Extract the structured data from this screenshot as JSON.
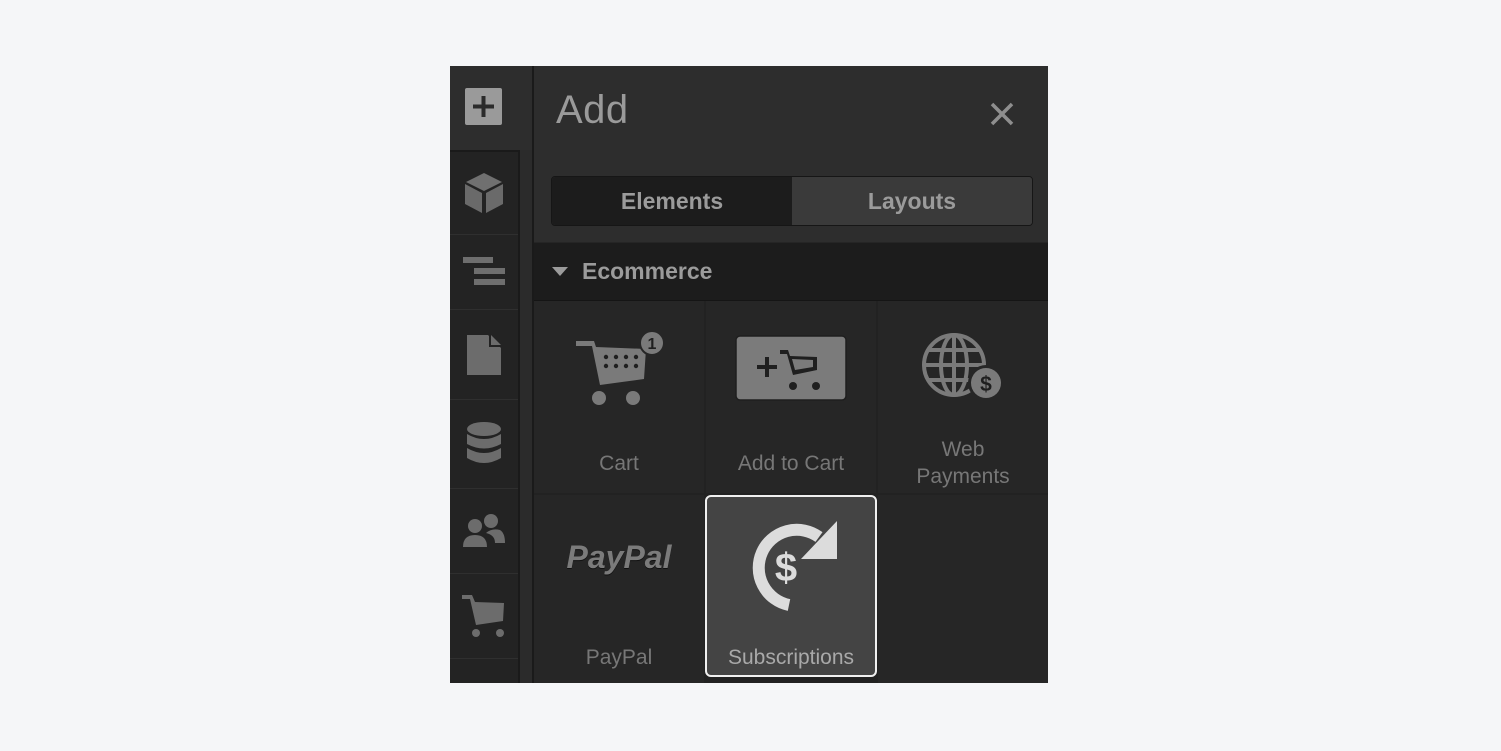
{
  "rail": {
    "items": [
      {
        "name": "add",
        "icon": "plus-box-icon"
      },
      {
        "name": "components",
        "icon": "cube-icon"
      },
      {
        "name": "navigator",
        "icon": "navigator-lines-icon"
      },
      {
        "name": "pages",
        "icon": "page-icon"
      },
      {
        "name": "cms",
        "icon": "database-icon"
      },
      {
        "name": "users",
        "icon": "users-icon"
      },
      {
        "name": "ecommerce",
        "icon": "cart-icon"
      }
    ]
  },
  "panel": {
    "title": "Add",
    "close_icon": "close-icon",
    "tabs": [
      {
        "label": "Elements",
        "active": true
      },
      {
        "label": "Layouts",
        "active": false
      }
    ],
    "section": {
      "label": "Ecommerce",
      "expanded": true,
      "items": [
        {
          "label": "Cart",
          "icon": "cart-with-badge-icon",
          "badge": "1",
          "selected": false
        },
        {
          "label": "Add to Cart",
          "icon": "add-to-cart-icon",
          "selected": false
        },
        {
          "label_line1": "Web",
          "label_line2": "Payments",
          "icon": "globe-dollar-icon",
          "selected": false
        },
        {
          "label": "PayPal",
          "icon": "paypal-logo",
          "logo_text": "PayPal",
          "selected": false
        },
        {
          "label": "Subscriptions",
          "icon": "recurring-dollar-icon",
          "selected": true
        }
      ]
    }
  },
  "colors": {
    "page_background": "#f5f6f8",
    "panel_background": "#2d2d2d",
    "text_muted": "#9b9b9b",
    "selected_border": "#f0f0f0"
  }
}
